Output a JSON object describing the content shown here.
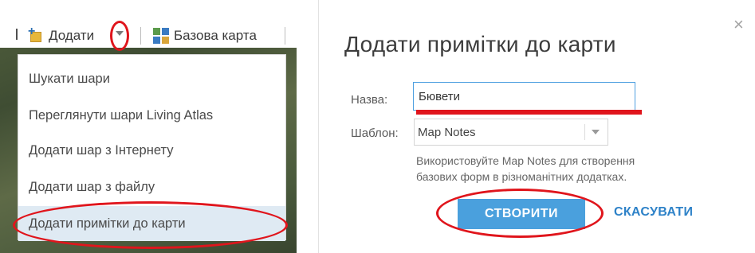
{
  "toolbar": {
    "add_label": "Додати",
    "basemap_label": "Базова карта"
  },
  "menu": {
    "items": [
      {
        "label": "Шукати шари"
      },
      {
        "label": "Переглянути шари Living Atlas"
      },
      {
        "label": "Додати шар з Інтернету"
      },
      {
        "label": "Додати шар з файлу"
      },
      {
        "label": "Додати примітки до карти",
        "active": true
      }
    ]
  },
  "dialog": {
    "title": "Додати примітки до карти",
    "name_label": "Назва:",
    "name_value": "Бювети",
    "template_label": "Шаблон:",
    "template_value": "Map Notes",
    "helper_line1": "Використовуйте Map Notes для створення",
    "helper_line2": "базових форм в різноманітних додатках.",
    "create_label": "СТВОРИТИ",
    "cancel_label": "СКАСУВАТИ",
    "close_symbol": "×"
  },
  "colors": {
    "accent": "#4aa0dd",
    "link": "#2e82c8",
    "highlight": "#e0151c",
    "active_item_bg": "#dfeaf3"
  },
  "icons": {
    "add": "add-layer-icon",
    "basemap": "basemap-grid-icon",
    "dropdown": "chevron-down-icon",
    "close": "close-icon"
  }
}
